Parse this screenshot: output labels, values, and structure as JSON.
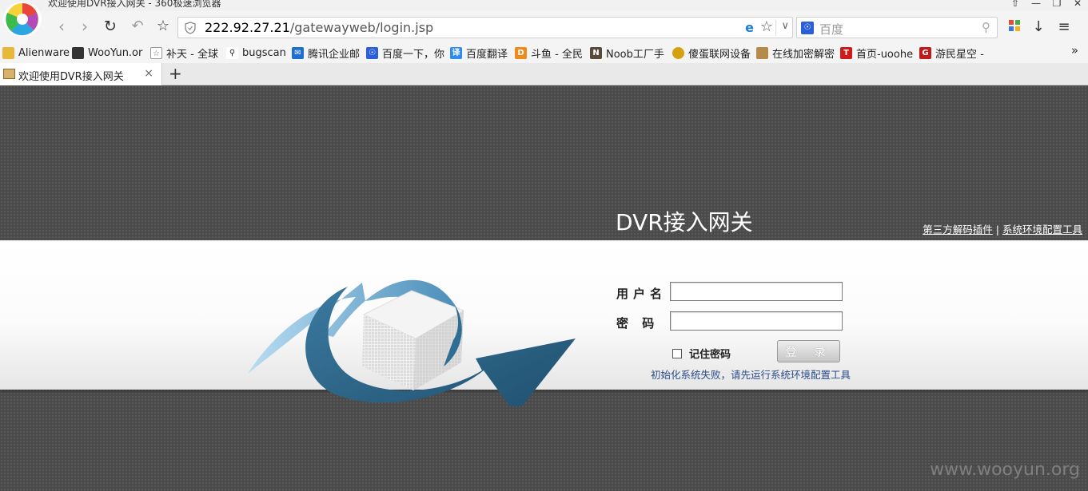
{
  "window": {
    "title": "欢迎使用DVR接入网关 - 360极速浏览器",
    "controls": [
      "⇧",
      "—",
      "❐",
      "✕"
    ]
  },
  "navbar": {
    "url_host": "222.92.27.21",
    "url_path": "/gatewayweb/login.jsp",
    "search_placeholder": "百度"
  },
  "bookmarks": [
    {
      "label": "Alienware",
      "icon": "folder-icon",
      "color": "#e8b83a"
    },
    {
      "label": "WooYun.or",
      "icon": "wooyun-icon",
      "color": "#333333"
    },
    {
      "label": "补天 - 全球",
      "icon": "butian-icon",
      "color": "#888888"
    },
    {
      "label": "bugscan",
      "icon": "bugscan-icon",
      "color": "#222222"
    },
    {
      "label": "腾讯企业邮",
      "icon": "tencent-mail-icon",
      "color": "#1f6fd0"
    },
    {
      "label": "百度一下，你",
      "icon": "baidu-icon",
      "color": "#2b5fd9"
    },
    {
      "label": "百度翻译",
      "icon": "baidu-translate-icon",
      "color": "#2e8bef"
    },
    {
      "label": "斗鱼 - 全民",
      "icon": "douyu-icon",
      "color": "#f08a1c"
    },
    {
      "label": "Noob工厂手",
      "icon": "noob-icon",
      "color": "#5a4a3a"
    },
    {
      "label": "傻蛋联网设备",
      "icon": "shodan-icon",
      "color": "#d4a010"
    },
    {
      "label": "在线加密解密",
      "icon": "crypto-icon",
      "color": "#b58a4a"
    },
    {
      "label": "首页-uoohe",
      "icon": "uoohe-icon",
      "color": "#d01a1a"
    },
    {
      "label": "游民星空 -",
      "icon": "gamersky-icon",
      "color": "#c01a1a"
    }
  ],
  "tab": {
    "title": "欢迎使用DVR接入网关",
    "close": "×",
    "new": "+"
  },
  "page": {
    "title": "DVR接入网关",
    "link_plugin": "第三方解码插件",
    "link_separator": "|",
    "link_env_tool": "系统环境配置工具",
    "username_label": "用户名",
    "password_label": "密 码",
    "remember_label": "记住密码",
    "login_button": "登 录",
    "status_message": "初始化系统失败，请先运行系统环境配置工具",
    "username_value": "",
    "password_value": ""
  },
  "watermark": "www.wooyun.org",
  "colors": {
    "page_bg": "#4a4a4a",
    "arrow_light": "#8fc3e6",
    "arrow_dark": "#2d6a8c",
    "status_text": "#2b4b8a"
  }
}
